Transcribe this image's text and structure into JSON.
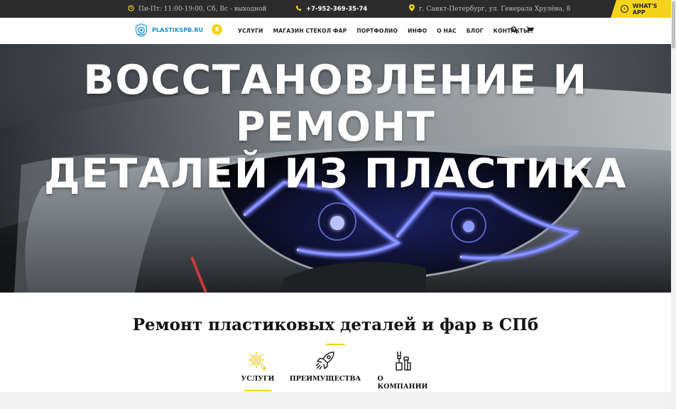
{
  "topbar": {
    "hours": "Пн-Пт: 11:00-19:00, Сб, Вс - выходной",
    "phone": "+7-952-369-35-74",
    "address": "г. Санкт-Петербург, ул. Генерала Хрулёва, 8",
    "whatsapp_label": "WHAT'S APP"
  },
  "nav": {
    "logo_text": "PLASTIKSPB.RU",
    "menu": [
      "УСЛУГИ",
      "МАГАЗИН СТЕКОЛ ФАР",
      "ПОРТФОЛИО",
      "ИНФО",
      "О НАС",
      "БЛОГ",
      "КОНТАКТЫ"
    ]
  },
  "hero": {
    "title_line1": "ВОССТАНОВЛЕНИЕ И РЕМОНТ",
    "title_line2": "ДЕТАЛЕЙ ИЗ ПЛАСТИКА"
  },
  "section": {
    "title": "Ремонт пластиковых деталей и фар в СПб",
    "tabs": [
      {
        "label": "УСЛУГИ",
        "icon": "gear-plus-icon",
        "active": true
      },
      {
        "label": "ПРЕИМУЩЕСТВА",
        "icon": "rocket-icon",
        "active": false
      },
      {
        "label": "О КОМПАНИИ",
        "icon": "tools-icon",
        "active": false
      }
    ]
  },
  "colors": {
    "accent": "#f5d31a",
    "topbar_bg": "#2b2b2b",
    "logo_blue": "#1c8fd0"
  }
}
